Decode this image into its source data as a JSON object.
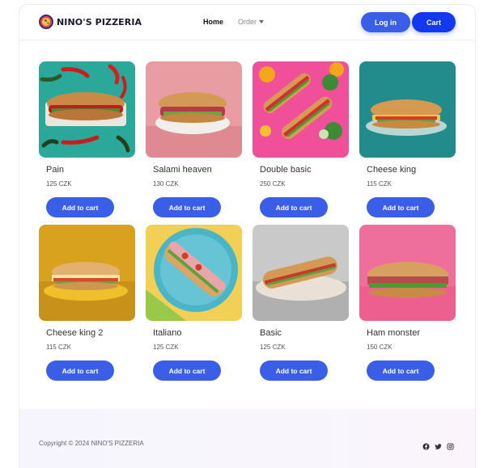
{
  "brand": {
    "name": "NINO'S PIZZERIA",
    "logo_icon": "pizza-logo-icon"
  },
  "nav": {
    "home": "Home",
    "order": "Order"
  },
  "header": {
    "login": "Log in",
    "cart": "Cart"
  },
  "products": [
    {
      "title": "Pain",
      "price": "125 CZK",
      "button": "Add to cart"
    },
    {
      "title": "Salami heaven",
      "price": "130 CZK",
      "button": "Add to cart"
    },
    {
      "title": "Double basic",
      "price": "250 CZK",
      "button": "Add to cart"
    },
    {
      "title": "Cheese king",
      "price": "115 CZK",
      "button": "Add to cart"
    },
    {
      "title": "Cheese king 2",
      "price": "115 CZK",
      "button": "Add to cart"
    },
    {
      "title": "Italiano",
      "price": "125 CZK",
      "button": "Add to cart"
    },
    {
      "title": "Basic",
      "price": "125 CZK",
      "button": "Add to cart"
    },
    {
      "title": "Ham monster",
      "price": "150 CZK",
      "button": "Add to cart"
    }
  ],
  "footer": {
    "copyright": "Copyright © 2024 NINO'S PIZZERIA",
    "social_icons": [
      "facebook-icon",
      "twitter-icon",
      "instagram-icon"
    ]
  },
  "colors": {
    "accent": "#3b5ee8",
    "cart": "#1238f0"
  }
}
